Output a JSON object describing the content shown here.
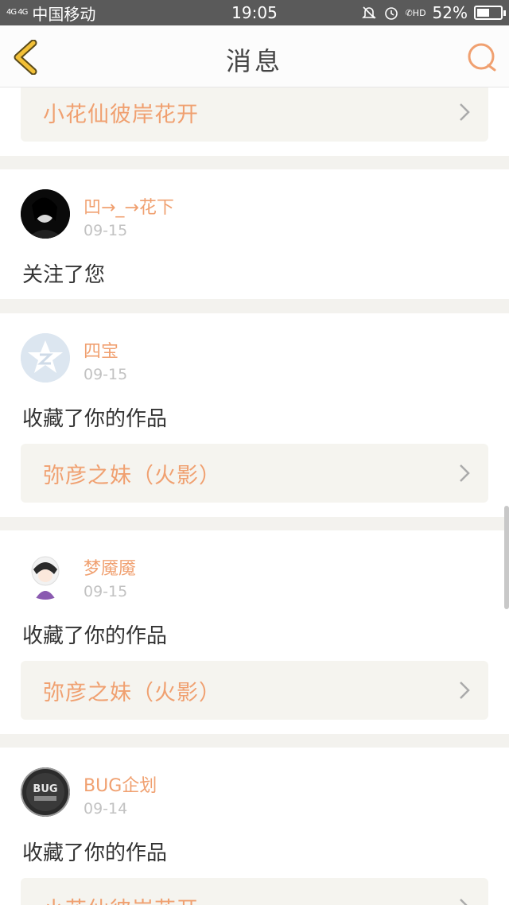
{
  "status_bar": {
    "network": "4G 4G",
    "carrier": "中国移动",
    "time": "19:05",
    "battery": "52%",
    "battery_level": 0.52,
    "call_icon_label": "HD"
  },
  "nav": {
    "title": "消息"
  },
  "messages": [
    {
      "work_title": "小花仙彼岸花开"
    },
    {
      "username": "凹→_→花下",
      "date": "09-15",
      "action": "关注了您"
    },
    {
      "username": "四宝",
      "date": "09-15",
      "action": "收藏了你的作品",
      "work_title": "弥彦之妹（火影）"
    },
    {
      "username": "梦魇魇",
      "date": "09-15",
      "action": "收藏了你的作品",
      "work_title": "弥彦之妹（火影）"
    },
    {
      "username": "BUG企划",
      "date": "09-14",
      "action": "收藏了你的作品",
      "work_title": "小花仙彼岸花开",
      "avatar_text": "BUG"
    }
  ],
  "colors": {
    "accent": "#f0a070",
    "back_icon": "#f2c037",
    "status_bar": "#5a5a5a",
    "background": "#f3f2ee"
  }
}
